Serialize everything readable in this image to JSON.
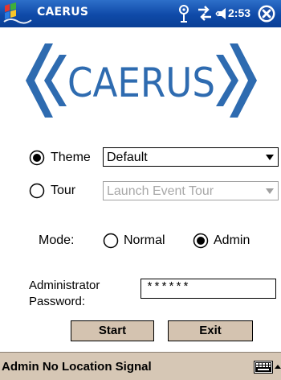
{
  "titlebar": {
    "app_title": "CAERUS",
    "clock": "2:53",
    "icons": [
      "start-flag-icon",
      "antenna-icon",
      "connectivity-icon",
      "speaker-icon",
      "close-icon"
    ]
  },
  "logo": {
    "text": "CAERUS",
    "color": "#2e6bb0"
  },
  "form": {
    "theme": {
      "label": "Theme",
      "selected": true,
      "value": "Default"
    },
    "tour": {
      "label": "Tour",
      "selected": false,
      "value": "Launch Event Tour",
      "disabled": true
    },
    "mode": {
      "label": "Mode:",
      "options": [
        {
          "label": "Normal",
          "selected": false
        },
        {
          "label": "Admin",
          "selected": true
        }
      ]
    },
    "password": {
      "label_line1": "Administrator",
      "label_line2": "Password:",
      "value": "******"
    }
  },
  "buttons": {
    "start": "Start",
    "exit": "Exit"
  },
  "menubar": {
    "text": "Admin No Location Signal"
  },
  "colors": {
    "titlebar": "#0f4aa8",
    "logo_blue": "#2e6bb0",
    "button_face": "#d4c3b0",
    "menubar": "#d6c7b5"
  }
}
